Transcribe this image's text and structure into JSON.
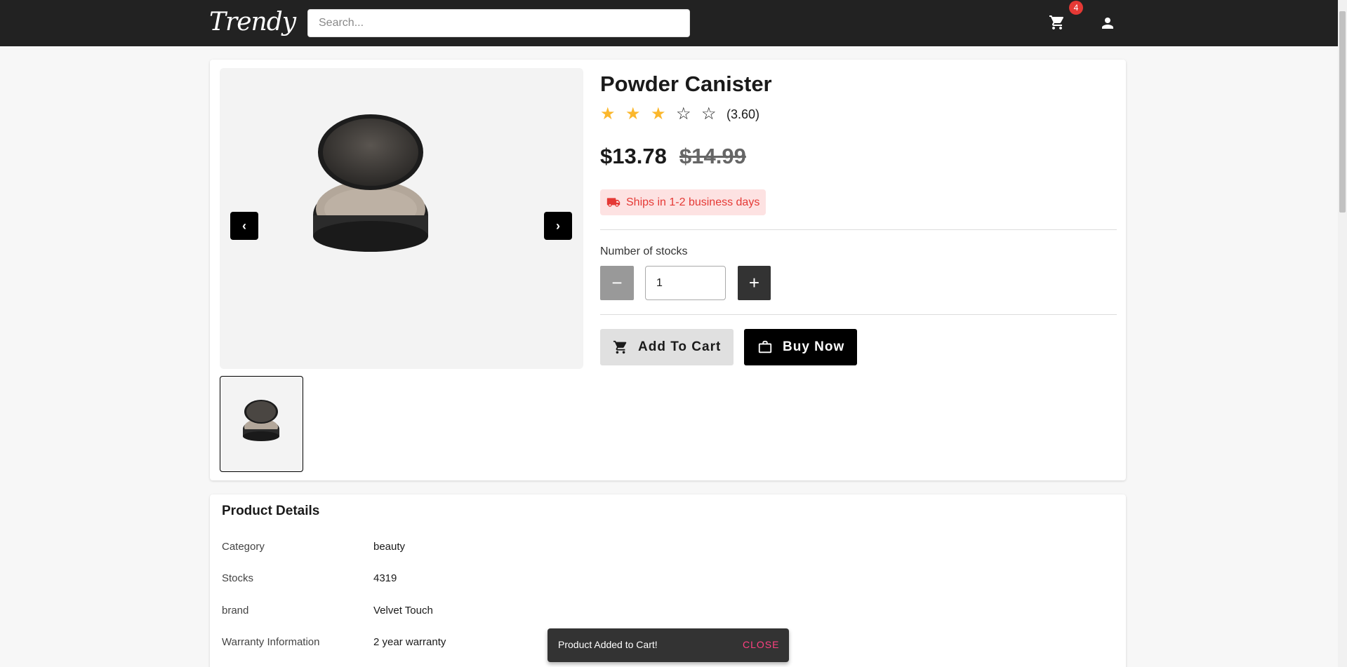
{
  "header": {
    "logo": "Trendy",
    "search_placeholder": "Search...",
    "cart_count": "4",
    "icons": [
      "cart-icon",
      "user-icon"
    ]
  },
  "product": {
    "title": "Powder Canister",
    "rating": 3.6,
    "rating_text": "(3.60)",
    "stars_filled": 3,
    "stars_total": 5,
    "price": "$13.78",
    "old_price": "$14.99",
    "shipping": "Ships in 1-2 business days",
    "stock_label": "Number of stocks",
    "quantity": "1",
    "minus_label": "−",
    "plus_label": "+",
    "add_to_cart": "Add To Cart",
    "buy_now": "Buy Now",
    "prev_label": "‹",
    "next_label": "›"
  },
  "details": {
    "title": "Product Details",
    "rows": [
      {
        "key": "Category",
        "value": "beauty"
      },
      {
        "key": "Stocks",
        "value": "4319"
      },
      {
        "key": "brand",
        "value": "Velvet Touch"
      },
      {
        "key": "Warranty Information",
        "value": "2 year warranty"
      }
    ]
  },
  "snackbar": {
    "message": "Product Added to Cart!",
    "close": "CLOSE"
  },
  "colors": {
    "header_bg": "#222222",
    "star": "#fbb72c",
    "shipping_text": "#e53935",
    "shipping_bg": "#fde2e2",
    "snackbar_close": "#ff4081"
  }
}
